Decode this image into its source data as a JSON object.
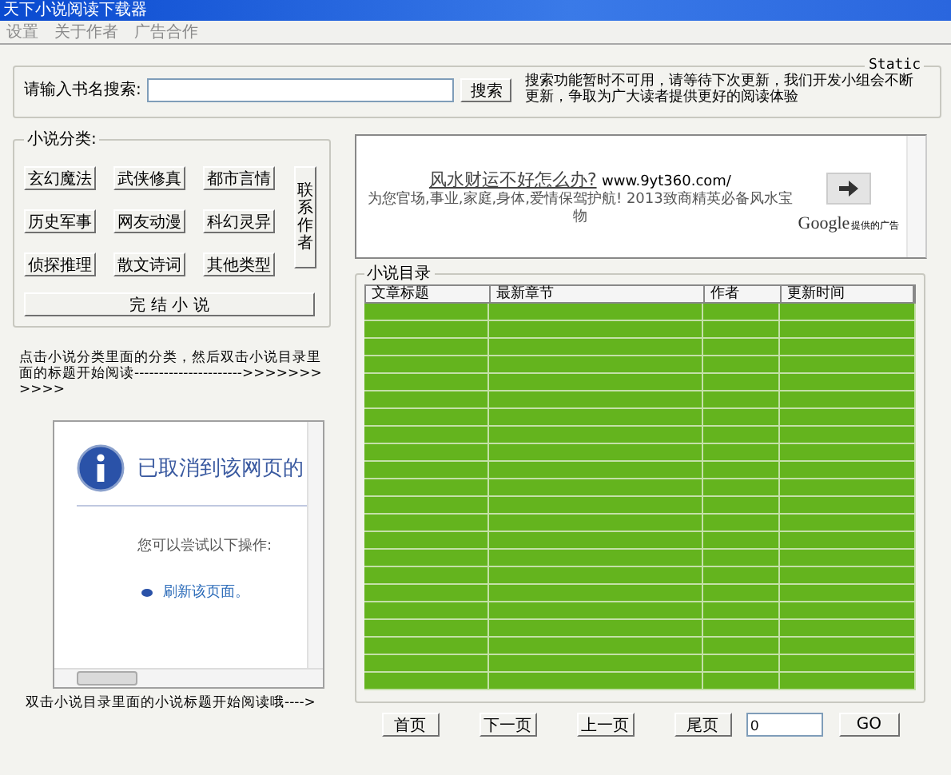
{
  "window": {
    "title": "天下小说阅读下载器"
  },
  "menu": [
    {
      "label": "设置"
    },
    {
      "label": "关于作者"
    },
    {
      "label": "广告合作"
    }
  ],
  "search": {
    "group_title": "Static",
    "label": "请输入书名搜索:",
    "button": "搜索",
    "notice": "搜索功能暂时不可用，请等待下次更新，我们开发小组会不断更新，争取为广大读者提供更好的阅读体验"
  },
  "categories": {
    "group_title": "小说分类:",
    "buttons": [
      "玄幻魔法",
      "武侠修真",
      "都市言情",
      "历史军事",
      "网友动漫",
      "科幻灵异",
      "侦探推理",
      "散文诗词",
      "其他类型"
    ],
    "contact_button": "联系作者",
    "finished_button": "完 结 小 说"
  },
  "hint_top": "点击小说分类里面的分类，然后双击小说目录里面的标题开始阅读---------------------->>>>>>>>>>>",
  "browser": {
    "heading": "已取消到该网页的",
    "subtext": "您可以尝试以下操作:",
    "link": "刷新该页面。"
  },
  "hint_bottom": "双击小说目录里面的小说标题开始阅读哦---->",
  "ad": {
    "headline": "风水财运不好怎么办?",
    "url": "www.9yt360.com/",
    "description": "为您官场,事业,家庭,身体,爱情保驾护航! 2013致商精英必备风水宝物",
    "brand": "Google",
    "brand_note": "提供的广告"
  },
  "table": {
    "group_title": "小说目录",
    "columns": [
      "文章标题",
      "最新章节",
      "作者",
      "更新时间"
    ]
  },
  "pager": {
    "buttons": [
      "首页",
      "下一页",
      "上一页",
      "尾页"
    ],
    "page_value": "0",
    "go": "GO"
  }
}
